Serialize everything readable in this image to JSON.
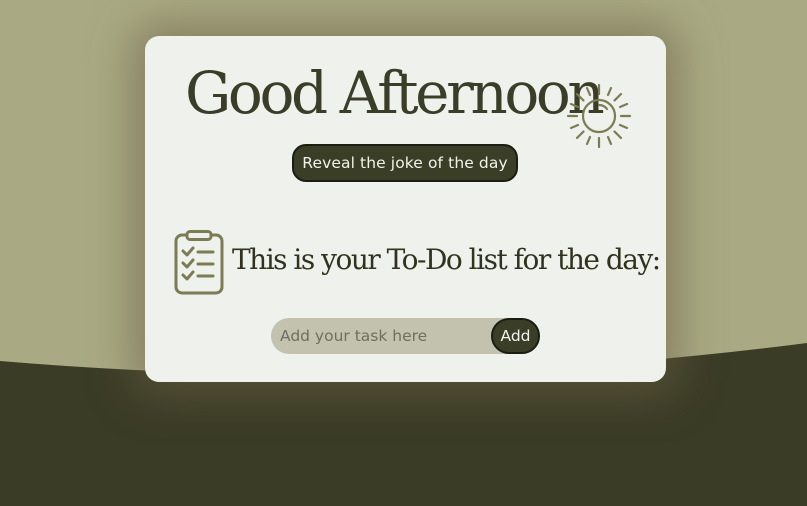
{
  "page": {
    "greeting": "Good Afternoon",
    "joke_button_label": "Reveal the joke of the day",
    "todo_heading": "This is your To-Do list for the day:",
    "task_input": {
      "placeholder": "Add your task here",
      "value": ""
    },
    "add_button_label": "Add"
  },
  "icons": {
    "greeting_icon": "sun-icon",
    "todo_icon": "clipboard-checklist-icon"
  },
  "colors": {
    "background_light": "#a9aa84",
    "background_dark": "#3b3c26",
    "card": "#eef1ec",
    "text_dark": "#3a3d27",
    "button": "#3b3e27",
    "button_text": "#f1f2ea",
    "input": "#c3c2ae",
    "icon": "#7c7c54"
  }
}
